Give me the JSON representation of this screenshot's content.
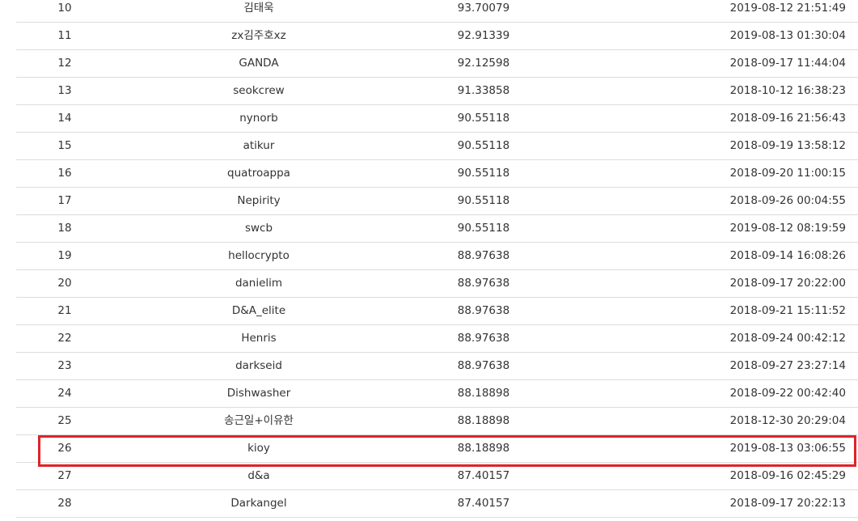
{
  "leaderboard": {
    "rows": [
      {
        "rank": "10",
        "name": "김태욱",
        "score": "93.70079",
        "time": "2019-08-12 21:51:49"
      },
      {
        "rank": "11",
        "name": "zx김주호xz",
        "score": "92.91339",
        "time": "2019-08-13 01:30:04"
      },
      {
        "rank": "12",
        "name": "GANDA",
        "score": "92.12598",
        "time": "2018-09-17 11:44:04"
      },
      {
        "rank": "13",
        "name": "seokcrew",
        "score": "91.33858",
        "time": "2018-10-12 16:38:23"
      },
      {
        "rank": "14",
        "name": "nynorb",
        "score": "90.55118",
        "time": "2018-09-16 21:56:43"
      },
      {
        "rank": "15",
        "name": "atikur",
        "score": "90.55118",
        "time": "2018-09-19 13:58:12"
      },
      {
        "rank": "16",
        "name": "quatroappa",
        "score": "90.55118",
        "time": "2018-09-20 11:00:15"
      },
      {
        "rank": "17",
        "name": "Nepirity",
        "score": "90.55118",
        "time": "2018-09-26 00:04:55"
      },
      {
        "rank": "18",
        "name": "swcb",
        "score": "90.55118",
        "time": "2019-08-12 08:19:59"
      },
      {
        "rank": "19",
        "name": "hellocrypto",
        "score": "88.97638",
        "time": "2018-09-14 16:08:26"
      },
      {
        "rank": "20",
        "name": "danielim",
        "score": "88.97638",
        "time": "2018-09-17 20:22:00"
      },
      {
        "rank": "21",
        "name": "D&A_elite",
        "score": "88.97638",
        "time": "2018-09-21 15:11:52"
      },
      {
        "rank": "22",
        "name": "Henris",
        "score": "88.97638",
        "time": "2018-09-24 00:42:12"
      },
      {
        "rank": "23",
        "name": "darkseid",
        "score": "88.97638",
        "time": "2018-09-27 23:27:14"
      },
      {
        "rank": "24",
        "name": "Dishwasher",
        "score": "88.18898",
        "time": "2018-09-22 00:42:40"
      },
      {
        "rank": "25",
        "name": "송근일+이유한",
        "score": "88.18898",
        "time": "2018-12-30 20:29:04"
      },
      {
        "rank": "26",
        "name": "kioy",
        "score": "88.18898",
        "time": "2019-08-13 03:06:55"
      },
      {
        "rank": "27",
        "name": "d&a",
        "score": "87.40157",
        "time": "2018-09-16 02:45:29"
      },
      {
        "rank": "28",
        "name": "Darkangel",
        "score": "87.40157",
        "time": "2018-09-17 20:22:13"
      }
    ],
    "highlighted_rank": "26",
    "highlight_color": "#e0222b",
    "divider_color": "#dddddd",
    "text_color": "#333333"
  }
}
